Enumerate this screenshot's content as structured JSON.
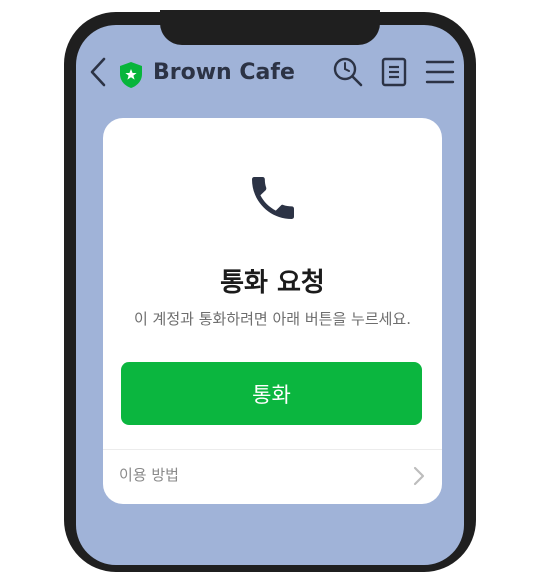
{
  "header": {
    "title": "Brown Cafe",
    "icons": [
      "back-icon",
      "verified-shield-icon",
      "search-icon",
      "document-icon",
      "menu-icon"
    ],
    "shield_color": "#07b53b"
  },
  "card": {
    "icon": "phone-icon",
    "title": "통화 요청",
    "description": "이 계정과 통화하려면 아래 버튼을 누르세요.",
    "call_button_label": "통화",
    "call_button_color": "#0bb63f",
    "howto_label": "이용 방법"
  },
  "colors": {
    "screen_background": "#a0b3d8",
    "phone_frame": "#1f1f1f",
    "icon_dark": "#2c3345"
  }
}
